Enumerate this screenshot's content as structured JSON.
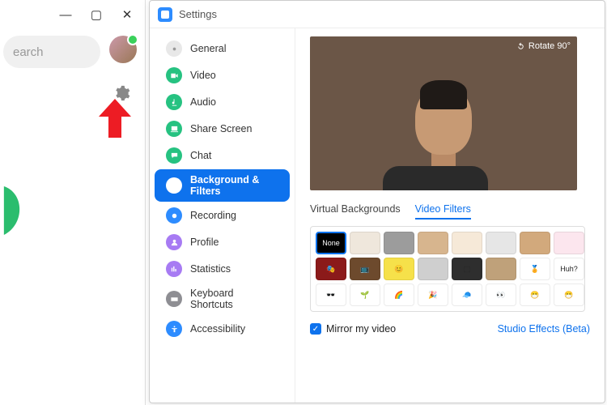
{
  "back": {
    "search_placeholder": "earch"
  },
  "settings": {
    "title": "Settings",
    "sidebar": [
      {
        "label": "General",
        "color": "#e8e8e8",
        "icon": "gear"
      },
      {
        "label": "Video",
        "color": "#26c281",
        "icon": "video"
      },
      {
        "label": "Audio",
        "color": "#26c281",
        "icon": "audio"
      },
      {
        "label": "Share Screen",
        "color": "#26c281",
        "icon": "share"
      },
      {
        "label": "Chat",
        "color": "#26c281",
        "icon": "chat"
      },
      {
        "label": "Background & Filters",
        "color": "#0e72ed",
        "icon": "bg",
        "active": true
      },
      {
        "label": "Recording",
        "color": "#2d8cff",
        "icon": "rec"
      },
      {
        "label": "Profile",
        "color": "#a77bf3",
        "icon": "profile"
      },
      {
        "label": "Statistics",
        "color": "#a77bf3",
        "icon": "stats"
      },
      {
        "label": "Keyboard Shortcuts",
        "color": "#8e8e93",
        "icon": "kbd"
      },
      {
        "label": "Accessibility",
        "color": "#2d8cff",
        "icon": "access"
      }
    ],
    "rotate_label": "Rotate 90°",
    "tabs": {
      "virtual": "Virtual Backgrounds",
      "filters": "Video Filters"
    },
    "filters": [
      {
        "key": "none",
        "label": "None",
        "bg": "#000"
      },
      {
        "key": "f1",
        "bg": "#efe7dc"
      },
      {
        "key": "f2",
        "bg": "#9c9c9c"
      },
      {
        "key": "f3",
        "bg": "#d7b58e"
      },
      {
        "key": "f4",
        "bg": "#f6e9d8"
      },
      {
        "key": "f5",
        "bg": "#e6e6e6"
      },
      {
        "key": "f6",
        "bg": "#d2a97c"
      },
      {
        "key": "f7",
        "bg": "#fce6ee"
      },
      {
        "key": "f8",
        "bg": "#8b1a1a"
      },
      {
        "key": "f9",
        "bg": "#6d4a2d"
      },
      {
        "key": "f10",
        "bg": "#f6e14a"
      },
      {
        "key": "f11",
        "bg": "#cfcfcf"
      },
      {
        "key": "f12",
        "bg": "#2e2e2e"
      },
      {
        "key": "f13",
        "bg": "#bfa17a"
      },
      {
        "key": "f14",
        "bg": "#ffffff"
      },
      {
        "key": "f15",
        "bg": "#ffffff",
        "label": "Huh?"
      },
      {
        "key": "f16",
        "bg": "#ffffff"
      },
      {
        "key": "f17",
        "bg": "#ffffff"
      },
      {
        "key": "f18",
        "bg": "#ffffff"
      },
      {
        "key": "f19",
        "bg": "#ffffff"
      },
      {
        "key": "f20",
        "bg": "#ffffff"
      },
      {
        "key": "f21",
        "bg": "#ffffff"
      },
      {
        "key": "f22",
        "bg": "#ffffff"
      },
      {
        "key": "f23",
        "bg": "#ffffff"
      }
    ],
    "mirror_label": "Mirror my video",
    "studio_label": "Studio Effects (Beta)"
  }
}
